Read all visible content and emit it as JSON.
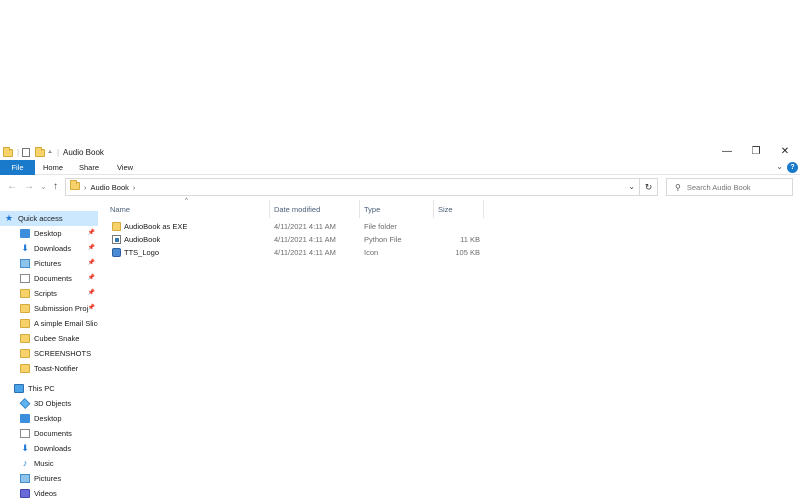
{
  "window": {
    "title": "Audio Book",
    "controls": {
      "minimize": "—",
      "maximize": "❐",
      "close": "✕"
    }
  },
  "ribbon": {
    "tabs": [
      "File",
      "Home",
      "Share",
      "View"
    ],
    "expand": "⌄",
    "help": "?"
  },
  "navigation": {
    "back": "←",
    "forward": "→",
    "recent": "⌄",
    "up": "↑",
    "breadcrumb": [
      "Audio Book"
    ],
    "separator": "›",
    "dropdown": "⌄",
    "refresh": "↻",
    "search_placeholder": "Search Audio Book",
    "search_icon": "⚲"
  },
  "sidebar": {
    "quick_access": {
      "label": "Quick access",
      "items": [
        {
          "label": "Desktop",
          "icon": "desktop-icon",
          "pinned": true
        },
        {
          "label": "Downloads",
          "icon": "download-icon",
          "pinned": true
        },
        {
          "label": "Pictures",
          "icon": "pictures-icon",
          "pinned": true
        },
        {
          "label": "Documents",
          "icon": "documents-icon",
          "pinned": true
        },
        {
          "label": "Scripts",
          "icon": "folder-icon",
          "pinned": true
        },
        {
          "label": "Submission Proj",
          "icon": "folder-icon",
          "pinned": true
        },
        {
          "label": "A simple Email Slice",
          "icon": "folder-icon",
          "pinned": false
        },
        {
          "label": "Cubee Snake",
          "icon": "folder-icon",
          "pinned": false
        },
        {
          "label": "SCREENSHOTS",
          "icon": "folder-icon",
          "pinned": false
        },
        {
          "label": "Toast-Notifier",
          "icon": "folder-icon",
          "pinned": false
        }
      ]
    },
    "this_pc": {
      "label": "This PC",
      "items": [
        {
          "label": "3D Objects",
          "icon": "3d-objects-icon"
        },
        {
          "label": "Desktop",
          "icon": "desktop-icon"
        },
        {
          "label": "Documents",
          "icon": "documents-icon"
        },
        {
          "label": "Downloads",
          "icon": "download-icon"
        },
        {
          "label": "Music",
          "icon": "music-icon"
        },
        {
          "label": "Pictures",
          "icon": "pictures-icon"
        },
        {
          "label": "Videos",
          "icon": "videos-icon"
        }
      ]
    },
    "pin_glyph": "📌"
  },
  "file_list": {
    "columns": [
      "Name",
      "Date modified",
      "Type",
      "Size"
    ],
    "sort_indicator": "^",
    "rows": [
      {
        "name": "AudioBook as EXE",
        "date": "4/11/2021 4:11 AM",
        "type": "File folder",
        "size": "",
        "icon": "folder-icon"
      },
      {
        "name": "AudioBook",
        "date": "4/11/2021 4:11 AM",
        "type": "Python File",
        "size": "11 KB",
        "icon": "python-file-icon"
      },
      {
        "name": "TTS_Logo",
        "date": "4/11/2021 4:11 AM",
        "type": "Icon",
        "size": "105 KB",
        "icon": "image-icon"
      }
    ]
  },
  "colors": {
    "accent": "#1979ca",
    "selection": "#cce8ff",
    "folder": "#f7d26b"
  }
}
